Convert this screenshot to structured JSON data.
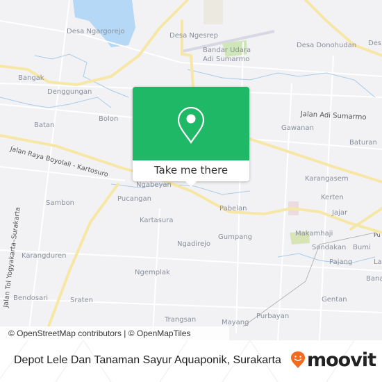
{
  "map": {
    "labels": [
      {
        "text": "Desa Ngargorejo"
      },
      {
        "text": "Desa Ngesrep"
      },
      {
        "text": "Bandar Udara"
      },
      {
        "text": "Adi Sumarmo"
      },
      {
        "text": "Desa Donohudan"
      },
      {
        "text": "Des"
      },
      {
        "text": "Bangak"
      },
      {
        "text": "Denggungan"
      },
      {
        "text": "Bolon"
      },
      {
        "text": "Batan"
      },
      {
        "text": "Jalan Raya Boyolali - Kartosuro"
      },
      {
        "text": "Jalan Adi Sumarmo"
      },
      {
        "text": "Gawanan"
      },
      {
        "text": "Baturan"
      },
      {
        "text": "Karangasem"
      },
      {
        "text": "Kerten"
      },
      {
        "text": "Jajar"
      },
      {
        "text": "Ngabeyan"
      },
      {
        "text": "Pucangan"
      },
      {
        "text": "Pabelan"
      },
      {
        "text": "Sambon"
      },
      {
        "text": "Kartasura"
      },
      {
        "text": "Makamhaji"
      },
      {
        "text": "Pu"
      },
      {
        "text": "Gumpang"
      },
      {
        "text": "Ngadirejo"
      },
      {
        "text": "Sondakan"
      },
      {
        "text": "Bumi"
      },
      {
        "text": "Pajang"
      },
      {
        "text": "La"
      },
      {
        "text": "Karangduren"
      },
      {
        "text": "Jalan Tol Yogyakarta–Surakarta"
      },
      {
        "text": "Bana"
      },
      {
        "text": "Ngemplak"
      },
      {
        "text": "Bendosari"
      },
      {
        "text": "Sraten"
      },
      {
        "text": "Gentan"
      },
      {
        "text": "Purbayan"
      },
      {
        "text": "Trangsan"
      },
      {
        "text": "Mayang"
      }
    ],
    "attribution": "© OpenStreetMap contributors | © OpenMapTiles",
    "colors": {
      "background": "#f2f2f4",
      "road": "#f7e7a6",
      "water": "#b4d8f5",
      "park": "#cfe6b8"
    }
  },
  "popup": {
    "icon": "map-pin-icon",
    "button_label": "Take me there",
    "color": "#1fb866"
  },
  "footer": {
    "title": "Depot Lele Dan Tanaman Sayur Aquaponik, Surakarta",
    "brand": "moovit",
    "brand_icon": "moovit-pin-smile-icon",
    "brand_color": "#f26b21"
  }
}
